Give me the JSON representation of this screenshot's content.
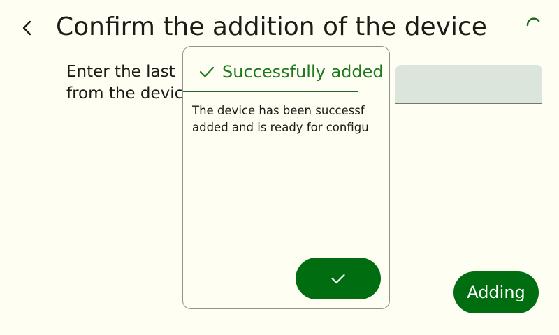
{
  "header": {
    "title": "Confirm the addition of the device",
    "back_icon": "chevron-left-icon",
    "status_icon": "loading-spinner-icon"
  },
  "main": {
    "prompt_line1": "Enter the last",
    "prompt_line2": "from the devic",
    "code_input_value": ""
  },
  "adding_button": {
    "label": "Adding"
  },
  "dialog": {
    "icon": "check-icon",
    "title": "Successfully added",
    "message_line1": "The device has been successf",
    "message_line2": "added and is ready for configu",
    "confirm_icon": "check-icon"
  },
  "colors": {
    "background": "#fefef3",
    "primary": "#006e10",
    "title_green": "#1e7a1f",
    "field_bg": "#dce5dc",
    "outline": "#8f948c"
  }
}
